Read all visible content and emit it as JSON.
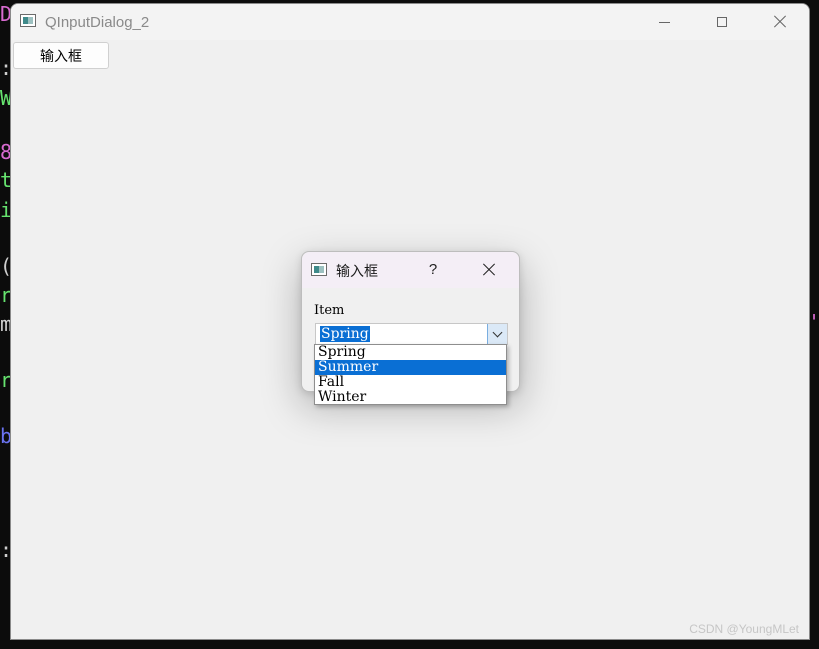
{
  "background_code": {
    "glyphs": [
      {
        "text": "D",
        "color": "#d96bd1"
      },
      {
        "text": ":",
        "color": "#cfcfcf"
      },
      {
        "text": "W",
        "color": "#66e36f"
      },
      {
        "text": "8",
        "color": "#d96bd1"
      },
      {
        "text": "t",
        "color": "#66e36f"
      },
      {
        "text": "i",
        "color": "#66e36f"
      },
      {
        "text": "(",
        "color": "#cfcfcf"
      },
      {
        "text": "r",
        "color": "#66e36f"
      },
      {
        "text": "m",
        "color": "#cfcfcf"
      },
      {
        "text": "r",
        "color": "#66e36f"
      },
      {
        "text": "b",
        "color": "#6a73f0"
      },
      {
        "text": ":",
        "color": "#cfcfcf"
      }
    ],
    "right_glyph": "'"
  },
  "window": {
    "title": "QInputDialog_2",
    "open_button_label": "输入框"
  },
  "dialog": {
    "title": "输入框",
    "help_label": "?",
    "field_label": "Item",
    "selected_value": "Spring",
    "options": [
      "Spring",
      "Summer",
      "Fall",
      "Winter"
    ],
    "highlighted_option": "Summer"
  },
  "watermark": "CSDN @YoungMLet",
  "colors": {
    "selection": "#0a6fd4",
    "window_bg": "#f0f0f0",
    "dialog_titlebar": "#f4eef6"
  }
}
